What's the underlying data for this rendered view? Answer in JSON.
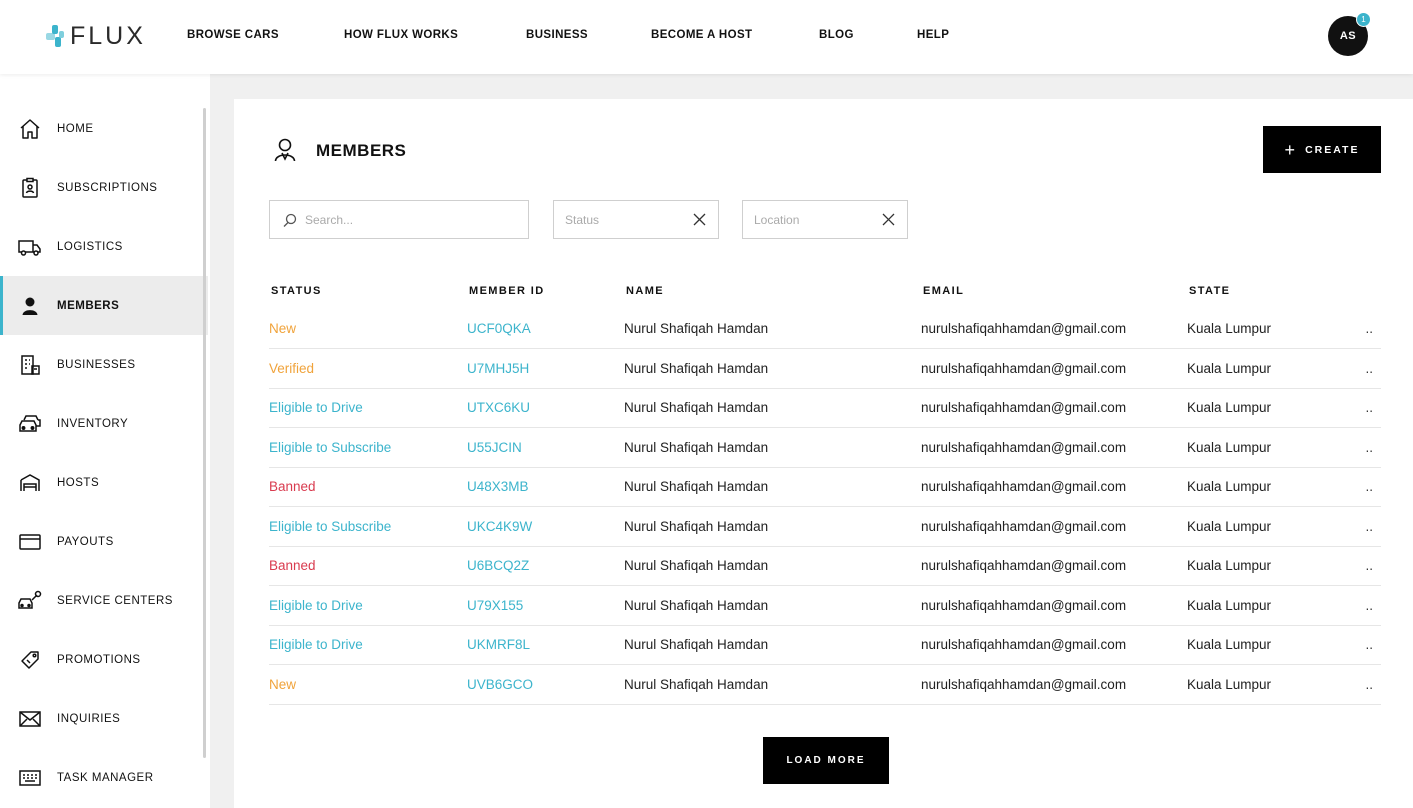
{
  "brand": {
    "name": "FLUX",
    "colors": {
      "accent": "#3cb4cc",
      "orange": "#f0a33b",
      "red": "#d93b4f"
    }
  },
  "nav": [
    "BROWSE CARS",
    "HOW FLUX WORKS",
    "BUSINESS",
    "BECOME A HOST",
    "BLOG",
    "HELP"
  ],
  "user": {
    "initials": "AS",
    "notifications": "1"
  },
  "sidebar": {
    "items": [
      {
        "label": "HOME",
        "icon": "home-icon"
      },
      {
        "label": "SUBSCRIPTIONS",
        "icon": "clipboard-user-icon"
      },
      {
        "label": "LOGISTICS",
        "icon": "truck-icon"
      },
      {
        "label": "MEMBERS",
        "icon": "user-icon",
        "active": true
      },
      {
        "label": "BUSINESSES",
        "icon": "building-icon"
      },
      {
        "label": "INVENTORY",
        "icon": "cars-icon"
      },
      {
        "label": "HOSTS",
        "icon": "garage-icon"
      },
      {
        "label": "PAYOUTS",
        "icon": "card-icon"
      },
      {
        "label": "SERVICE CENTERS",
        "icon": "car-wrench-icon"
      },
      {
        "label": "PROMOTIONS",
        "icon": "tag-icon"
      },
      {
        "label": "INQUIRIES",
        "icon": "mail-icon"
      },
      {
        "label": "TASK MANAGER",
        "icon": "keyboard-icon"
      }
    ]
  },
  "page": {
    "title": "MEMBERS",
    "create_label": "CREATE",
    "search_placeholder": "Search...",
    "status_placeholder": "Status",
    "location_placeholder": "Location",
    "load_more_label": "LOAD MORE"
  },
  "table": {
    "headers": [
      "STATUS",
      "MEMBER ID",
      "NAME",
      "EMAIL",
      "STATE"
    ],
    "rows": [
      {
        "status": "New",
        "kind": "new",
        "id": "UCF0QKA",
        "name": "Nurul Shafiqah Hamdan",
        "email": "nurulshafiqahhamdan@gmail.com",
        "state": "Kuala Lumpur",
        "more": ".."
      },
      {
        "status": "Verified",
        "kind": "verified",
        "id": "U7MHJ5H",
        "name": "Nurul Shafiqah Hamdan",
        "email": "nurulshafiqahhamdan@gmail.com",
        "state": "Kuala Lumpur",
        "more": ".."
      },
      {
        "status": "Eligible to Drive",
        "kind": "eligible",
        "id": "UTXC6KU",
        "name": "Nurul Shafiqah Hamdan",
        "email": "nurulshafiqahhamdan@gmail.com",
        "state": "Kuala Lumpur",
        "more": ".."
      },
      {
        "status": "Eligible to Subscribe",
        "kind": "eligible",
        "id": "U55JCIN",
        "name": "Nurul Shafiqah Hamdan",
        "email": "nurulshafiqahhamdan@gmail.com",
        "state": "Kuala Lumpur",
        "more": ".."
      },
      {
        "status": "Banned",
        "kind": "banned",
        "id": "U48X3MB",
        "name": "Nurul Shafiqah Hamdan",
        "email": "nurulshafiqahhamdan@gmail.com",
        "state": "Kuala Lumpur",
        "more": ".."
      },
      {
        "status": "Eligible to Subscribe",
        "kind": "eligible",
        "id": "UKC4K9W",
        "name": "Nurul Shafiqah Hamdan",
        "email": "nurulshafiqahhamdan@gmail.com",
        "state": "Kuala Lumpur",
        "more": ".."
      },
      {
        "status": "Banned",
        "kind": "banned",
        "id": "U6BCQ2Z",
        "name": "Nurul Shafiqah Hamdan",
        "email": "nurulshafiqahhamdan@gmail.com",
        "state": "Kuala Lumpur",
        "more": ".."
      },
      {
        "status": "Eligible to Drive",
        "kind": "eligible",
        "id": "U79X155",
        "name": "Nurul Shafiqah Hamdan",
        "email": "nurulshafiqahhamdan@gmail.com",
        "state": "Kuala Lumpur",
        "more": ".."
      },
      {
        "status": "Eligible to Drive",
        "kind": "eligible",
        "id": "UKMRF8L",
        "name": "Nurul Shafiqah Hamdan",
        "email": "nurulshafiqahhamdan@gmail.com",
        "state": "Kuala Lumpur",
        "more": ".."
      },
      {
        "status": "New",
        "kind": "new",
        "id": "UVB6GCO",
        "name": "Nurul Shafiqah Hamdan",
        "email": "nurulshafiqahhamdan@gmail.com",
        "state": "Kuala Lumpur",
        "more": ".."
      }
    ]
  }
}
